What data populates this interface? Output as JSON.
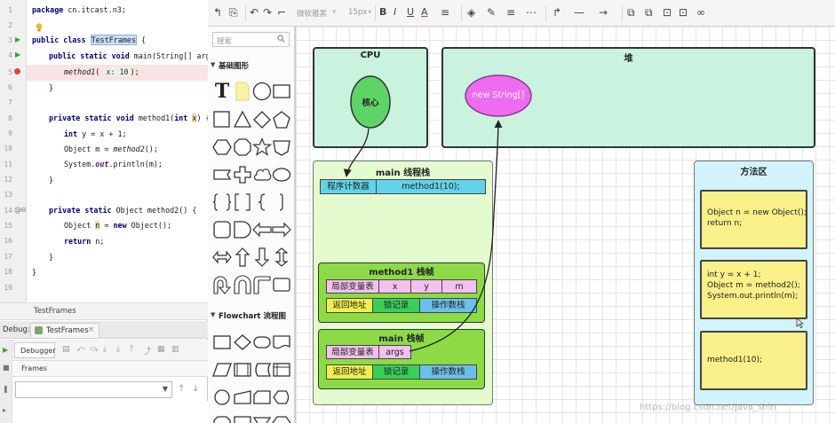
{
  "ide": {
    "line_numbers": [
      "1",
      "2",
      "3",
      "4",
      "5",
      "6",
      "7",
      "8",
      "9",
      "10",
      "11",
      "12",
      "13",
      "14",
      "15",
      "16",
      "17",
      "18",
      "19"
    ],
    "code": {
      "l1_pkg_kw": "package",
      "l1_pkg_name": " cn.itcast.n3;",
      "l3_a": "public class ",
      "l3_cls": "TestFrames",
      "l3_b": " {",
      "l4_a": "public static void",
      "l4_b": " main(String[] args) {",
      "l5_fn": "method1",
      "l5_b": "( ",
      "l5_param": "x: 10",
      "l5_c": ");",
      "l6": "}",
      "l8_a": "private static void",
      "l8_b": " method1(",
      "l8_c": "int",
      "l8_d": " ",
      "l8_e": "x",
      "l8_f": ") {",
      "l9_a": "int",
      "l9_b": " y = x + 1;",
      "l10_a": "Object m = ",
      "l10_fn": "method2",
      "l10_b": "();",
      "l11_a": "System.",
      "l11_out": "out",
      "l11_b": ".println(m);",
      "l12": "}",
      "l14_a": "private static",
      "l14_b": " Object method2() {",
      "l15_a": "Object ",
      "l15_n": "n",
      "l15_b": " = ",
      "l15_new": "new",
      "l15_c": " Object();",
      "l16_a": "return",
      "l16_b": " n;",
      "l17": "}",
      "l18": "}"
    },
    "editor_status": "TestFrames",
    "debug_label": "Debug:",
    "debug_tab": "TestFrames",
    "debug_tab_close": "×",
    "debugger_tab": "Debugger",
    "frames_label": "Frames"
  },
  "toolbar": {
    "font_name": "微软雅黑",
    "font_size": "15px",
    "bold": "B",
    "italic": "I",
    "underline": "U",
    "font_color": "A"
  },
  "shapes_panel": {
    "search_placeholder": "搜索",
    "section_basic": "基础图形",
    "section_flowchart": "Flowchart 流程图",
    "text_tool": "T"
  },
  "diagram": {
    "cpu_title": "CPU",
    "core_label": "核心",
    "heap_title": "堆",
    "heap_object": "new String[]",
    "thread_stack_title": "main 线程栈",
    "pc_label": "程序计数器",
    "pc_value": "method1(10);",
    "method1_frame_title": "method1 栈帧",
    "m1_locals_label": "局部变量表",
    "m1_vars": [
      "x",
      "y",
      "m"
    ],
    "m1_return": "返回地址",
    "m1_lock": "锁记录",
    "m1_opstack": "操作数栈",
    "main_frame_title": "main 栈帧",
    "main_locals_label": "局部变量表",
    "main_var": "args",
    "main_return": "返回地址",
    "main_lock": "锁记录",
    "main_opstack": "操作数栈",
    "method_area_title": "方法区",
    "method_area_box1": "Object n = new Object();\nreturn n;",
    "method_area_box2": "int y = x + 1;\nObject m = method2();\nSystem.out.println(m);",
    "method_area_box3": "method1(10);"
  },
  "watermark": "https://blog.csdn.net/java_shin",
  "colors": {
    "cpu_fill": "#c9f2df",
    "core_fill": "#5fd466",
    "heap_obj_fill": "#ee6cf0",
    "thread_stack_fill": "#e4fbcf",
    "frame_fill": "#8cdb46",
    "pc_fill": "#62d3ea",
    "locals_fill": "#f3c0f0",
    "return_fill": "#f0f050",
    "lock_fill": "#37d059",
    "opstack_fill": "#6cbfe8",
    "method_area_fill": "#d2f3fb",
    "method_box_fill": "#f9f08a"
  }
}
